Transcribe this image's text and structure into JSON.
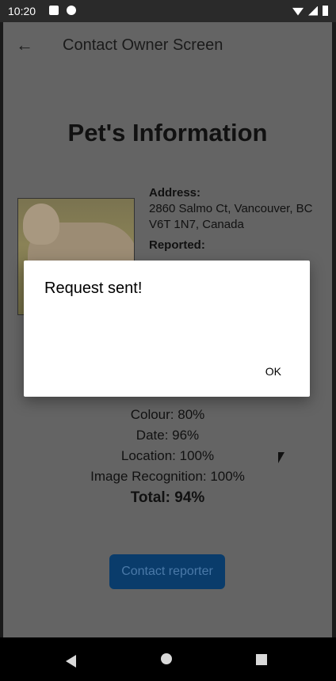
{
  "status": {
    "time": "10:20"
  },
  "appbar": {
    "title": "Contact Owner Screen"
  },
  "content": {
    "heading": "Pet's Information",
    "address_label": "Address:",
    "address_value": "2860 Salmo Ct, Vancouver, BC V6T 1N7, Canada",
    "reported_label": "Reported:",
    "scores": [
      "Colour: 80%",
      "Date: 96%",
      "Location: 100%",
      "Image Recognition: 100%"
    ],
    "total": "Total: 94%",
    "contact_button": "Contact reporter"
  },
  "dialog": {
    "message": "Request sent!",
    "ok": "OK"
  }
}
